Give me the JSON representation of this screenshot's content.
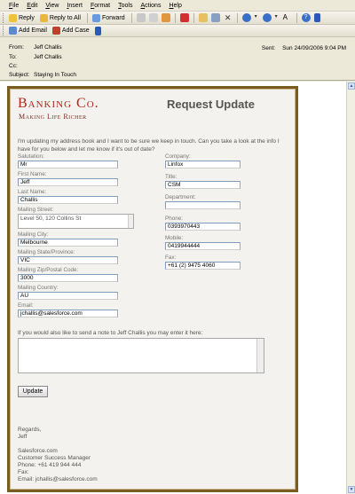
{
  "menu": [
    "File",
    "Edit",
    "View",
    "Insert",
    "Format",
    "Tools",
    "Actions",
    "Help"
  ],
  "toolbar": {
    "reply": "Reply",
    "reply_all": "Reply to All",
    "forward": "Forward"
  },
  "toolbar2": {
    "add_email": "Add Email",
    "add_case": "Add Case"
  },
  "header": {
    "from_label": "From:",
    "from": "Jeff Challis",
    "to_label": "To:",
    "to": "Jeff Challis",
    "cc_label": "Cc:",
    "cc": "",
    "subject_label": "Subject:",
    "subject": "Staying In Touch",
    "sent_label": "Sent:",
    "sent": "Sun 24/09/2006 9:04 PM"
  },
  "brand": {
    "name": "Banking Co.",
    "tagline": "Making Life Richer",
    "title": "Request Update",
    "colors": {
      "brand_red": "#b1261e",
      "frame": "#7a5c1e"
    }
  },
  "intro": "I'm updating my address book and I want to be sure we keep in touch. Can you take a look at the info I have for you below and let me know if it's out of date?",
  "left_fields": {
    "salutation_label": "Salutation:",
    "salutation": "Mr",
    "first_label": "First Name:",
    "first": "Jeff",
    "last_label": "Last Name:",
    "last": "Challis",
    "street_label": "Mailing Street:",
    "street": "Level 50, 120 Collins St",
    "city_label": "Mailing City:",
    "city": "Melbourne",
    "state_label": "Mailing State/Province:",
    "state": "VIC",
    "zip_label": "Mailing Zip/Postal Code:",
    "zip": "3000",
    "country_label": "Mailing Country:",
    "country": "AU",
    "email_label": "Email:",
    "email": "jchallis@salesforce.com"
  },
  "right_fields": {
    "company_label": "Company:",
    "company": "Linfox",
    "title_label": "Title:",
    "title": "CSM",
    "dept_label": "Department:",
    "dept": "",
    "phone_label": "Phone:",
    "phone": "0393970443",
    "mobile_label": "Mobile:",
    "mobile": "0419944444",
    "fax_label": "Fax:",
    "fax": "+61 (2) 9475 4060"
  },
  "note_label": "If you would also like to send a note to Jeff Challis you may enter it here:",
  "update_button": "Update",
  "signature": {
    "regards": "Regards,",
    "name": "Jeff",
    "company": "Salesforce.com",
    "role": "Customer Success Manager",
    "phone": "Phone: +61 419 944 444",
    "fax": "Fax:",
    "email": "Email: jchallis@salesforce.com"
  }
}
